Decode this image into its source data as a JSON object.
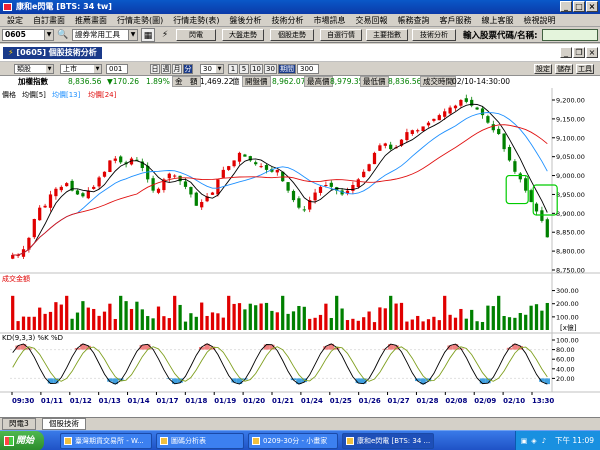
{
  "window": {
    "title": "康和e閃電 [BTS: 34 tw]"
  },
  "menu": [
    "設定",
    "自訂畫面",
    "推薦畫面",
    "行情走勢(圖)",
    "行情走勢(表)",
    "盤後分析",
    "技術分析",
    "市場訊息",
    "交易回報",
    "帳務查詢",
    "客戶服務",
    "線上客服",
    "檢視說明"
  ],
  "toolbar": {
    "stock_code": "0605",
    "tool_select": "證券常用工具",
    "buttons": [
      "閃電",
      "大盤走勢",
      "個股走勢",
      "自選行情",
      "主要指數",
      "技術分析",
      "即時新聞"
    ],
    "prompt": "輸入股票代碼/名稱:",
    "input_value": ""
  },
  "panel": {
    "title": "[0605] 個股技術分析"
  },
  "controls": {
    "category": "類股",
    "market": "上市",
    "code": "001",
    "periods": [
      "日",
      "週",
      "月",
      "分"
    ],
    "minutes": "30",
    "ranges": [
      "1",
      "5",
      "10",
      "30",
      "期間"
    ],
    "count": "300",
    "right_buttons": [
      "設定",
      "儲存",
      "工具"
    ]
  },
  "quote": {
    "name": "加權指數",
    "price": "8,836.56",
    "change": "▼170.26",
    "change_pct": "1.89%",
    "amount_label": "金　額",
    "amount": "1,469.22",
    "amount_unit": "億",
    "open_label": "開盤價",
    "open": "8,962.07",
    "high_label": "最高價",
    "high": "8,979.35",
    "low_label": "最低價",
    "low": "8,836.56",
    "time_label": "成交時間",
    "time": "02/10-14:30:00"
  },
  "legend": {
    "price": "價格",
    "ma1": "均價[5]",
    "ma2": "均價[13]",
    "ma3": "均價[24]",
    "volume": "成交金額",
    "kd": "KD(9,3,3) %K %D",
    "vol_unit": "[x億]"
  },
  "colors": {
    "up": "#e00000",
    "down": "#008000",
    "ma5": "#000000",
    "ma13": "#1e90ff",
    "ma24": "#e01010",
    "k_line": "#000000",
    "d_line": "#80a020",
    "highlight": "#00cc00",
    "panel_title": "#1a3a8a"
  },
  "chart_data": [
    {
      "type": "candlestick",
      "title": "價格",
      "series": [
        "均價[5]",
        "均價[13]",
        "均價[24]"
      ],
      "ylim": [
        8750,
        9200
      ],
      "yticks": [
        "9,200.00",
        "9,150.00",
        "9,100.00",
        "9,050.00",
        "9,000.00",
        "8,950.00",
        "8,900.00",
        "8,850.00",
        "8,800.00",
        "8,750.00"
      ],
      "close": [
        8790,
        8790,
        8805,
        8835,
        8885,
        8915,
        8920,
        8950,
        8965,
        8970,
        8980,
        8960,
        8950,
        8945,
        8960,
        8970,
        8995,
        9010,
        9040,
        9045,
        9035,
        9030,
        9045,
        9040,
        9020,
        8990,
        8960,
        8965,
        8990,
        9005,
        9000,
        8985,
        8970,
        8950,
        8920,
        8930,
        8945,
        8955,
        8990,
        9015,
        9025,
        9040,
        9060,
        9050,
        9040,
        9030,
        9025,
        9015,
        9010,
        9015,
        8985,
        8960,
        8935,
        8915,
        8910,
        8935,
        8955,
        8970,
        8975,
        8970,
        8960,
        8950,
        8960,
        8975,
        8990,
        9010,
        9030,
        9060,
        9080,
        9085,
        9070,
        9075,
        9095,
        9115,
        9120,
        9120,
        9130,
        9140,
        9150,
        9160,
        9170,
        9180,
        9185,
        9200,
        9195,
        9185,
        9175,
        9160,
        9140,
        9120,
        9110,
        9070,
        9040,
        9010,
        8990,
        8960,
        8930,
        8905,
        8880,
        8836.56
      ]
    },
    {
      "type": "bar",
      "title": "成交金額",
      "ylim": [
        0,
        350
      ],
      "yticks": [
        "300.00",
        "200.00",
        "100.00"
      ]
    },
    {
      "type": "line",
      "title": "KD(9,3,3)",
      "ylim": [
        0,
        100
      ],
      "yticks": [
        "100.00",
        "80.00",
        "60.00",
        "40.00",
        "20.00"
      ],
      "x_labels": [
        "09:30",
        "01/11",
        "01/12",
        "01/13",
        "01/14",
        "01/17",
        "01/18",
        "01/19",
        "01/20",
        "01/21",
        "01/24",
        "01/25",
        "01/26",
        "01/27",
        "01/28",
        "02/08",
        "02/09",
        "02/10",
        "13:30"
      ]
    }
  ],
  "bottom_tabs": [
    "閃電3",
    "個股技術"
  ],
  "taskbar": {
    "start": "開始",
    "items": [
      "臺灣期貨交易所 - W...",
      "圖碼分析表",
      "0209-30分 - 小畫家",
      "康和e閃電 [BTS: 34 ..."
    ],
    "clock": "下午 11:09"
  }
}
